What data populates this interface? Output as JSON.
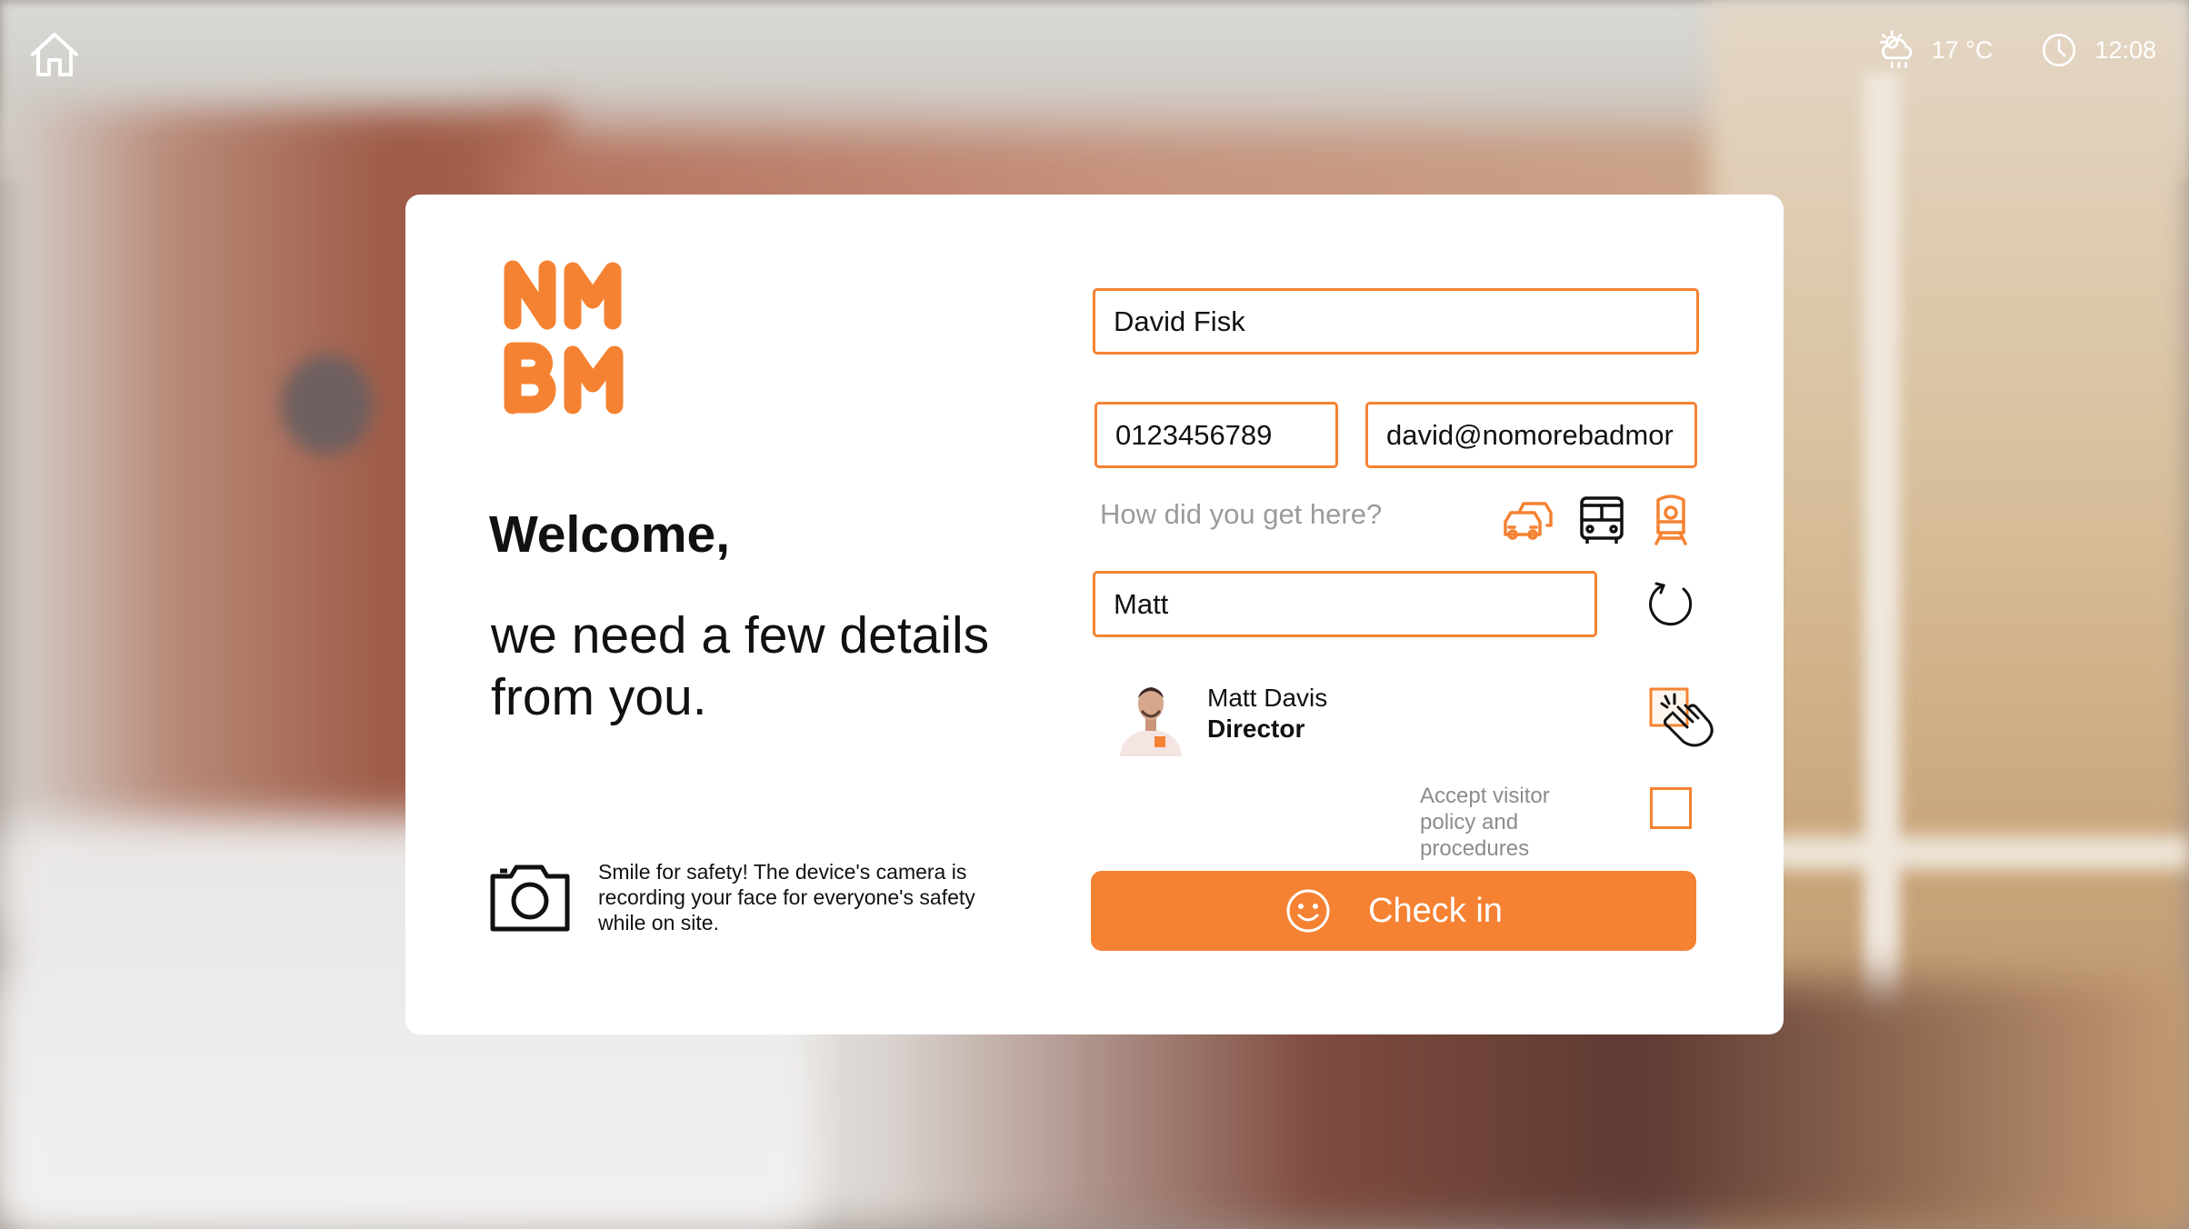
{
  "topbar": {
    "home_icon": "home-icon",
    "weather_icon": "weather-cloud-sun-rain-icon",
    "temperature": "17 °C",
    "clock_icon": "clock-icon",
    "time": "12:08"
  },
  "logo": {
    "lines": [
      "NM",
      "BM"
    ],
    "color": "#f58232"
  },
  "welcome": {
    "title": "Welcome,",
    "subtitle": "we need a few details from you."
  },
  "camera_note": {
    "icon": "camera-icon",
    "text": "Smile for safety! The device's camera is recording your face for everyone's safety while on site."
  },
  "form": {
    "name_value": "David Fisk",
    "phone_value": "0123456789",
    "email_value": "david@nomorebadmor",
    "transport_prompt": "How did you get here?",
    "transport_options": [
      {
        "icon": "car-icon",
        "color": "#f58232"
      },
      {
        "icon": "bus-icon",
        "color": "#111111"
      },
      {
        "icon": "train-icon",
        "color": "#f58232"
      }
    ],
    "host_search_value": "Matt",
    "refresh_icon": "refresh-icon"
  },
  "host_result": {
    "name": "Matt Davis",
    "role": "Director",
    "select_icon": "tap-hand-icon"
  },
  "policy": {
    "label": "Accept visitor policy and procedures",
    "checked": false
  },
  "checkin_button": {
    "label": "Check in",
    "icon": "smiley-icon",
    "color": "#f58232"
  }
}
